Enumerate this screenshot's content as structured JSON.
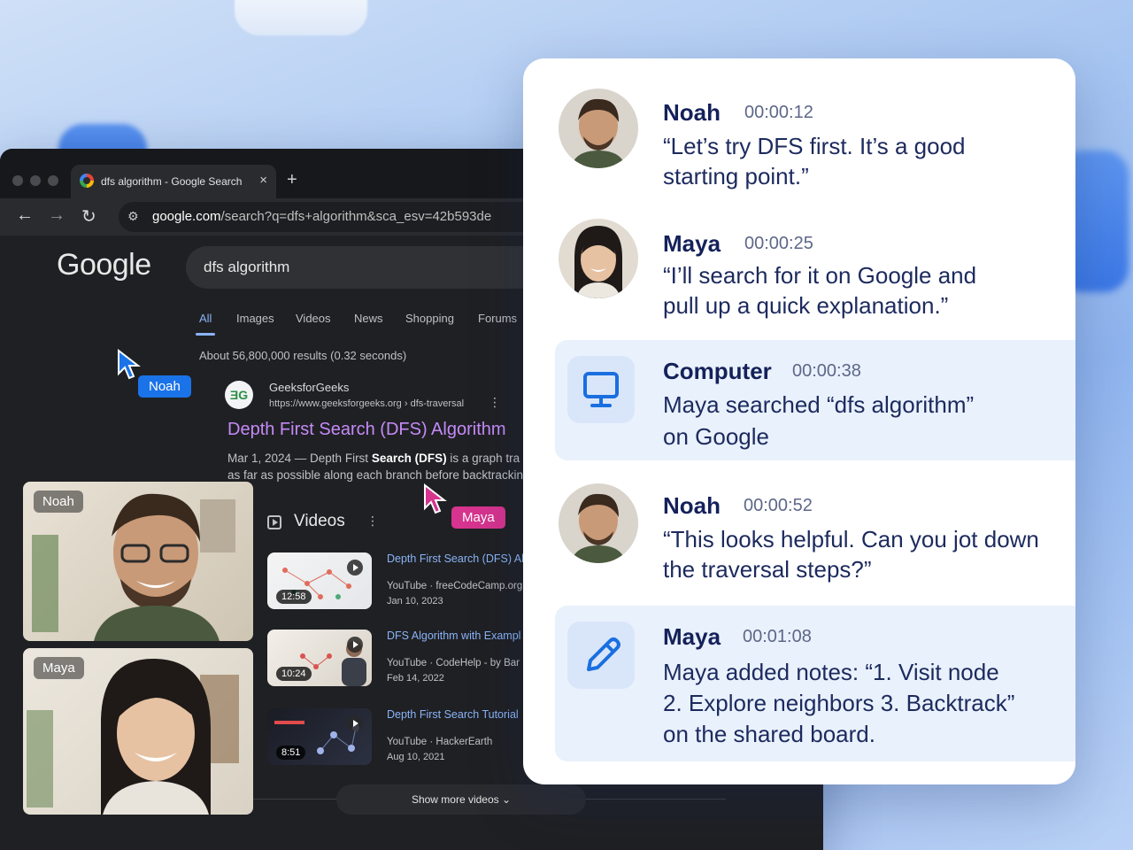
{
  "browser": {
    "tab_title": "dfs algorithm - Google Search",
    "tab_close": "×",
    "new_tab": "+",
    "url_host": "google.com",
    "url_path": "/search?q=dfs+algorithm&sca_esv=42b593de",
    "back": "←",
    "forward": "→",
    "reload": "↻"
  },
  "google": {
    "logo": "Google",
    "query": "dfs algorithm",
    "tabs": [
      "All",
      "Images",
      "Videos",
      "News",
      "Shopping",
      "Forums"
    ],
    "stats": "About 56,800,000 results (0.32 seconds)",
    "result": {
      "site_name": "GeeksforGeeks",
      "site_url": "https://www.geeksforgeeks.org › dfs-traversal",
      "title": "Depth First Search (DFS) Algorithm",
      "snippet_date": "Mar 1, 2024 — Depth First ",
      "snippet_bold1": "Search (DFS)",
      "snippet_rest1": " is a graph tra",
      "snippet_line2": "as far as possible along each branch before backtrackin"
    },
    "videos_heading": "Videos",
    "videos": [
      {
        "title": "Depth First Search (DFS) Al",
        "source": "YouTube · freeCodeCamp.org",
        "date": "Jan 10, 2023",
        "duration": "12:58"
      },
      {
        "title": "DFS Algorithm with Exampl",
        "source": "YouTube · CodeHelp - by Bar",
        "date": "Feb 14, 2022",
        "duration": "10:24"
      },
      {
        "title": "Depth First Search Tutorial",
        "source": "YouTube · HackerEarth",
        "date": "Aug 10, 2021",
        "duration": "8:51"
      }
    ],
    "show_more": "Show more videos  ⌄"
  },
  "cursors": {
    "noah": {
      "label": "Noah",
      "color": "#1a73e8"
    },
    "maya": {
      "label": "Maya",
      "color": "#d6348e"
    }
  },
  "call": {
    "tiles": [
      "Noah",
      "Maya"
    ]
  },
  "chat": [
    {
      "type": "person",
      "name": "Noah",
      "time": "00:00:12",
      "lines": [
        "“Let’s try DFS first. It’s a good",
        "starting point.”"
      ]
    },
    {
      "type": "person",
      "name": "Maya",
      "time": "00:00:25",
      "lines": [
        "“I’ll search for it on Google and",
        "pull up a quick explanation.”"
      ]
    },
    {
      "type": "system",
      "icon": "monitor-icon",
      "name": "Computer",
      "time": "00:00:38",
      "lines": [
        "Maya searched “dfs algorithm”",
        "on Google"
      ]
    },
    {
      "type": "person",
      "name": "Noah",
      "time": "00:00:52",
      "lines": [
        "“This looks helpful. Can you jot down",
        "the traversal steps?”"
      ]
    },
    {
      "type": "system",
      "icon": "pencil-icon",
      "name": "Maya",
      "time": "00:01:08",
      "lines": [
        "Maya added notes: “1. Visit node",
        "2. Explore neighbors 3. Backtrack”",
        "on the shared board."
      ]
    }
  ],
  "colors": {
    "accent": "#8ab4f8",
    "visited_link": "#c58af9",
    "chat_name": "#14215a",
    "chat_highlight": "#e9f1fc"
  }
}
